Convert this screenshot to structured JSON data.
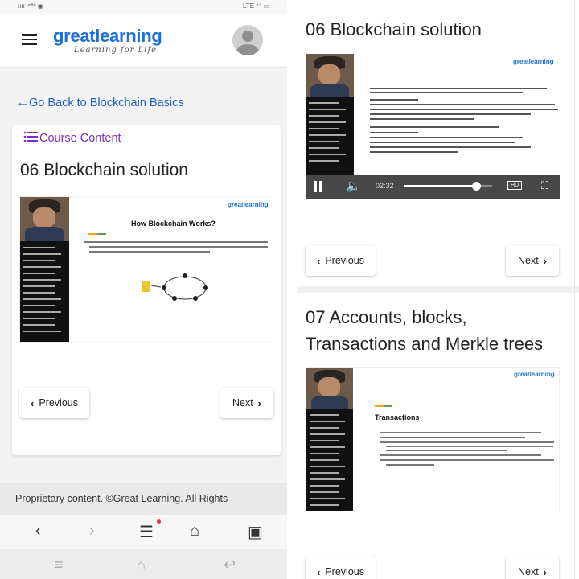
{
  "left_phone": {
    "status_bar": {
      "left": "ıııı ᵛᵒˡᵗᵉ ◉",
      "right": "LTE ⁺² ▭"
    },
    "header": {
      "logo_main": "greatlearning",
      "logo_sub": "Learning for Life"
    },
    "back_link": "Go Back to Blockchain Basics",
    "course_content_label": "Course Content",
    "lesson_title": "06 Blockchain solution",
    "slide": {
      "brand": "greatlearning",
      "heading": "How Blockchain Works?"
    },
    "buttons": {
      "previous": "Previous",
      "next": "Next"
    },
    "footer_text": "Proprietary content. ©Great Learning. All Rights"
  },
  "right_phone": {
    "lesson_title": "06 Blockchain solution",
    "video": {
      "brand": "greatlearning",
      "time": "02:32",
      "progress": 0.82,
      "quality": "HD"
    },
    "buttons": {
      "previous": "Previous",
      "next": "Next"
    },
    "next_lesson_title": "07 Accounts, blocks, Transactions and Merkle trees",
    "next_slide": {
      "brand": "greatlearning",
      "heading": "Transactions"
    },
    "bottom_buttons": {
      "previous": "Previous",
      "next": "Next"
    }
  },
  "colors": {
    "brand_blue": "#1d6fd8",
    "link_blue": "#1d5fc4",
    "purple": "#7b2ec4",
    "notification_red": "#e53935"
  },
  "icons": [
    "hamburger-icon",
    "avatar-icon",
    "back-arrow-icon",
    "list-icon",
    "chevron-left-icon",
    "chevron-right-icon",
    "play-pause-icon",
    "volume-icon",
    "fullscreen-icon",
    "browser-back-icon",
    "browser-forward-icon",
    "browser-menu-icon",
    "home-icon",
    "tabs-icon"
  ]
}
